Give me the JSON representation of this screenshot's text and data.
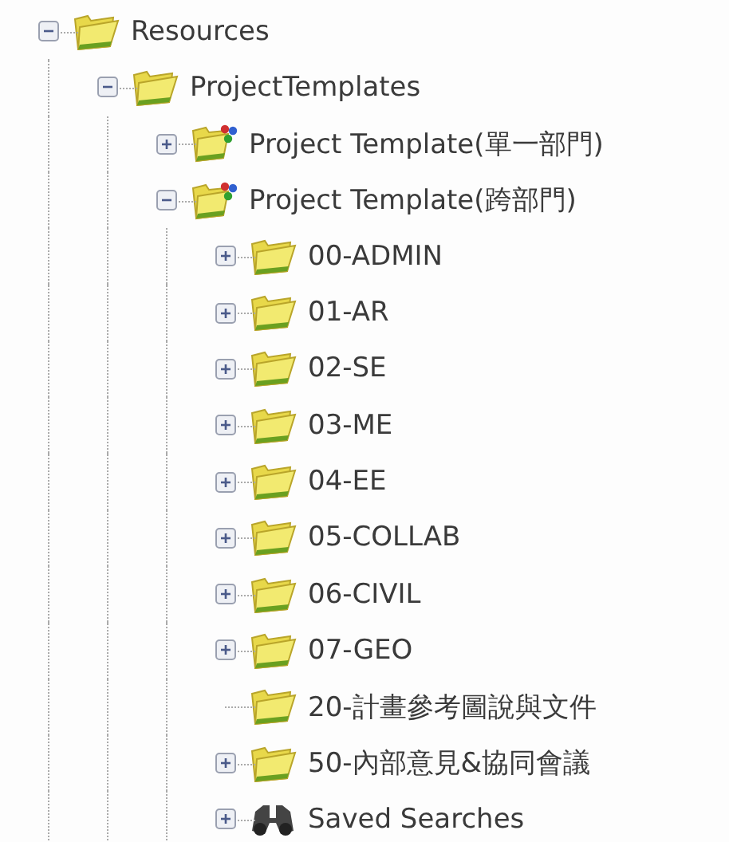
{
  "tree": [
    {
      "label": "Resources",
      "kind": "folder",
      "expanded": true,
      "children": [
        {
          "label": "ProjectTemplates",
          "kind": "folder",
          "expanded": true,
          "children": [
            {
              "label": "Project Template(單一部門)",
              "kind": "template",
              "expanded": false
            },
            {
              "label": "Project Template(跨部門)",
              "kind": "template",
              "expanded": true,
              "children": [
                {
                  "label": "00-ADMIN",
                  "kind": "folder",
                  "expanded": false
                },
                {
                  "label": "01-AR",
                  "kind": "folder",
                  "expanded": false
                },
                {
                  "label": "02-SE",
                  "kind": "folder",
                  "expanded": false
                },
                {
                  "label": "03-ME",
                  "kind": "folder",
                  "expanded": false
                },
                {
                  "label": "04-EE",
                  "kind": "folder",
                  "expanded": false
                },
                {
                  "label": "05-COLLAB",
                  "kind": "folder",
                  "expanded": false
                },
                {
                  "label": "06-CIVIL",
                  "kind": "folder",
                  "expanded": false
                },
                {
                  "label": "07-GEO",
                  "kind": "folder",
                  "expanded": false
                },
                {
                  "label": "20-計畫參考圖說與文件",
                  "kind": "folder"
                },
                {
                  "label": "50-內部意見&協同會議",
                  "kind": "folder",
                  "expanded": false
                },
                {
                  "label": "Saved Searches",
                  "kind": "search",
                  "expanded": false
                }
              ]
            }
          ]
        }
      ]
    }
  ]
}
